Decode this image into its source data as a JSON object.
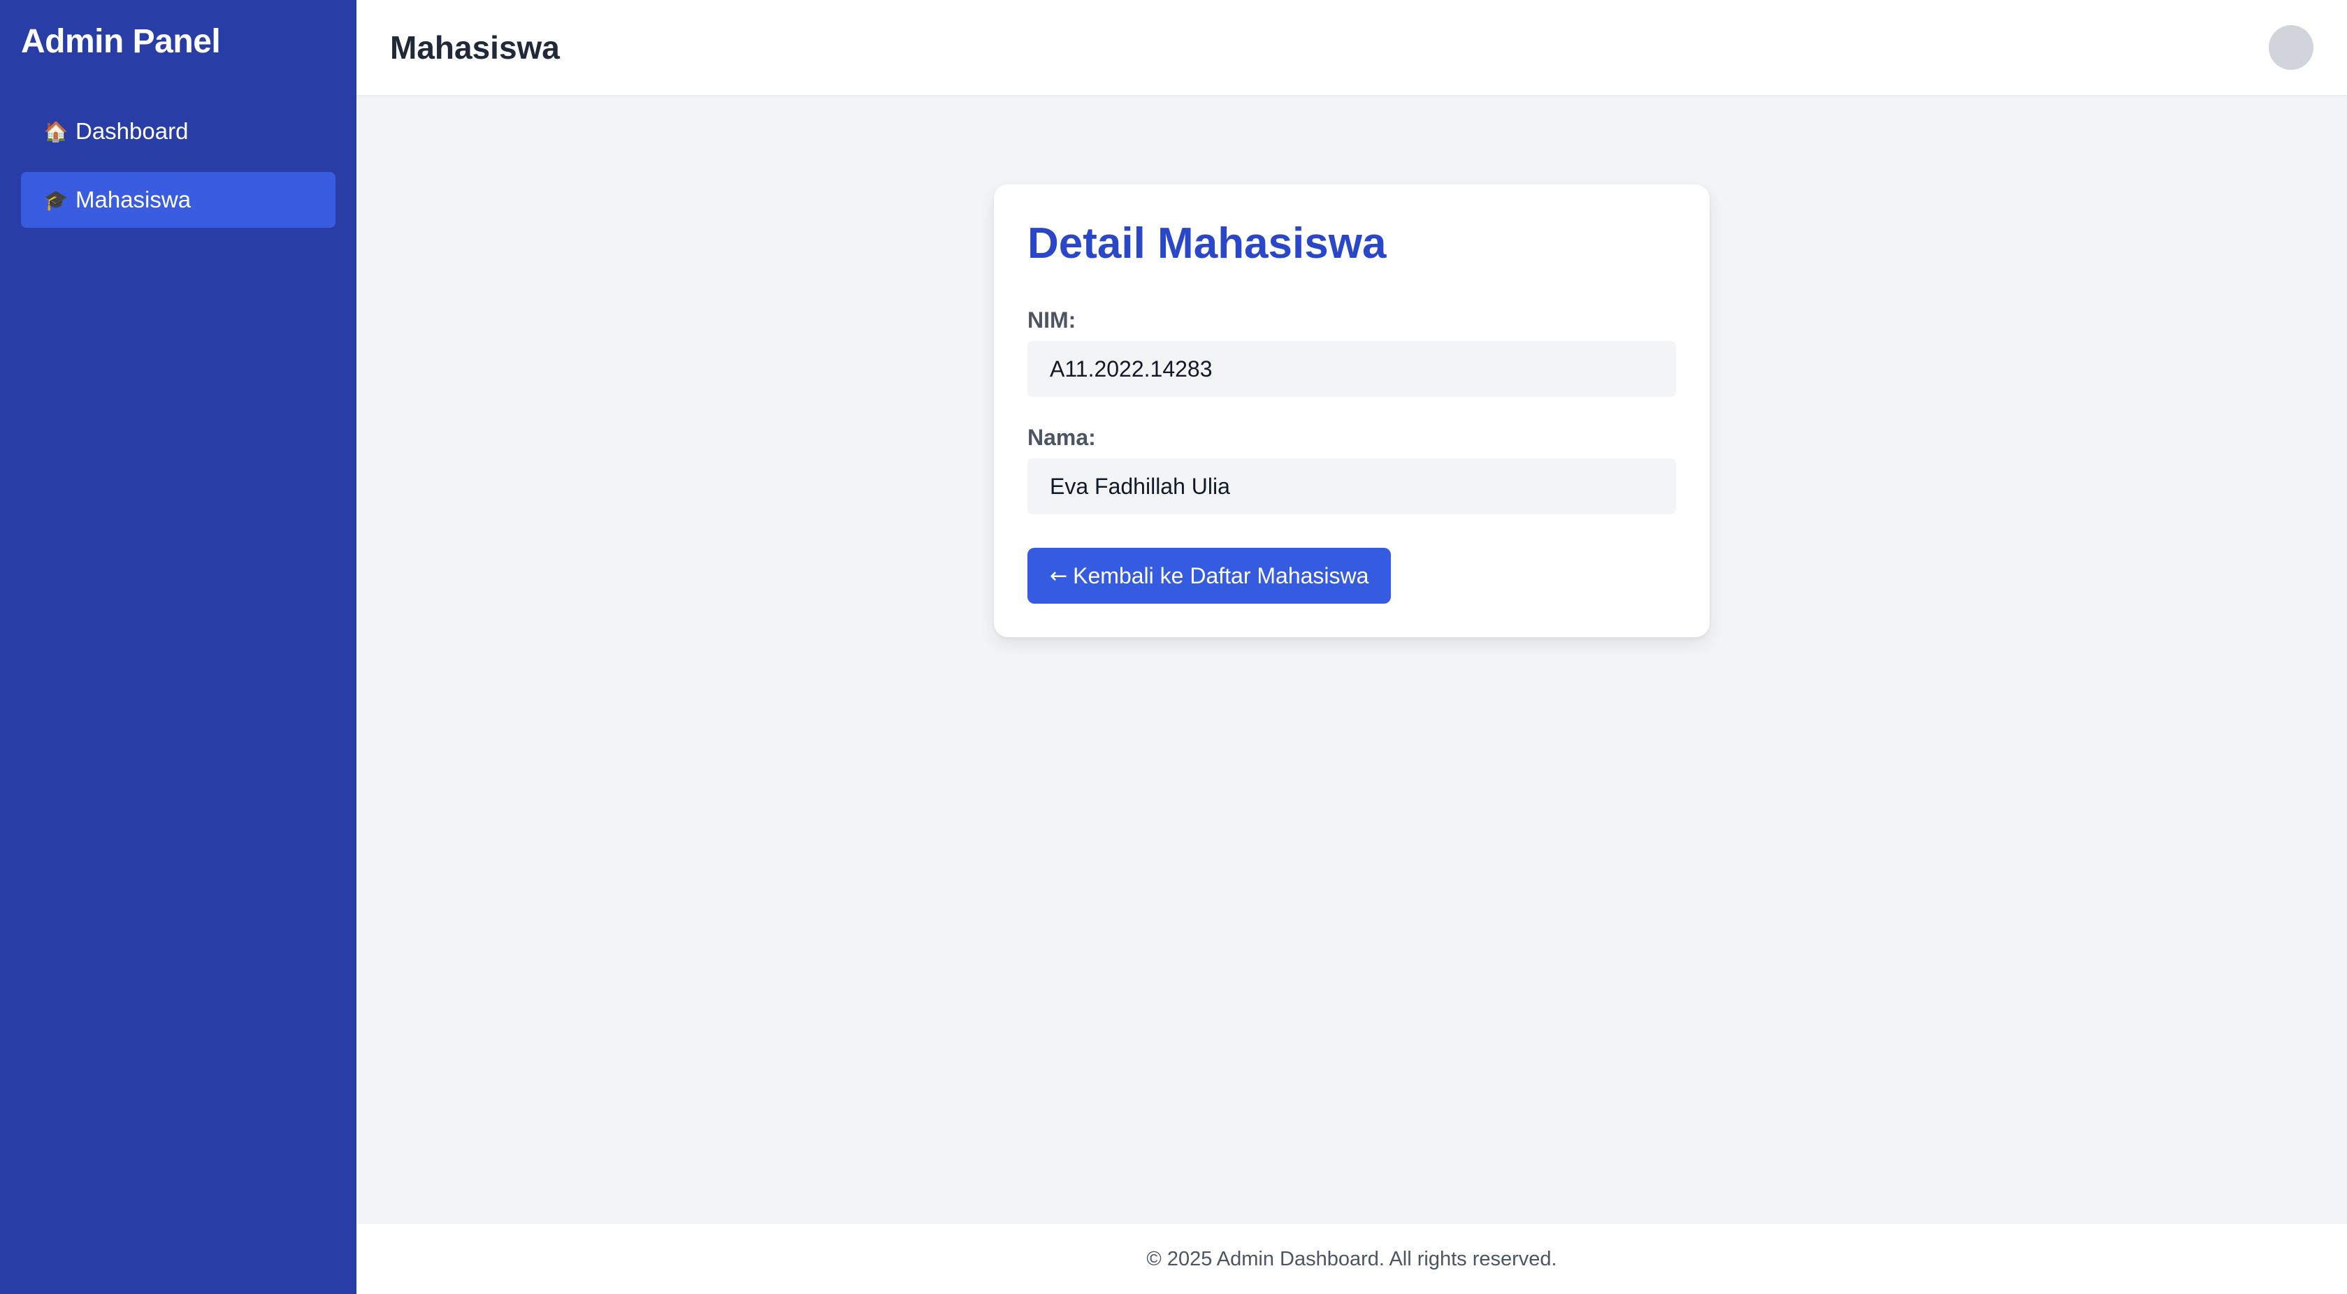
{
  "sidebar": {
    "title": "Admin Panel",
    "items": [
      {
        "icon": "🏠",
        "icon_name": "home-icon",
        "label": "Dashboard",
        "active": false
      },
      {
        "icon": "🎓",
        "icon_name": "graduation-cap-icon",
        "label": "Mahasiswa",
        "active": true
      }
    ]
  },
  "header": {
    "title": "Mahasiswa"
  },
  "card": {
    "title": "Detail Mahasiswa",
    "fields": [
      {
        "label": "NIM:",
        "value": "A11.2022.14283"
      },
      {
        "label": "Nama:",
        "value": "Eva Fadhillah Ulia"
      }
    ],
    "back_button": {
      "arrow": "←",
      "label": "Kembali ke Daftar Mahasiswa"
    }
  },
  "footer": {
    "text": "© 2025 Admin Dashboard. All rights reserved."
  },
  "colors": {
    "sidebar_bg": "#283ea6",
    "active_item": "#3a5ce0",
    "accent": "#2a47c9",
    "button": "#355ce0",
    "page_bg": "#f3f4f6"
  }
}
